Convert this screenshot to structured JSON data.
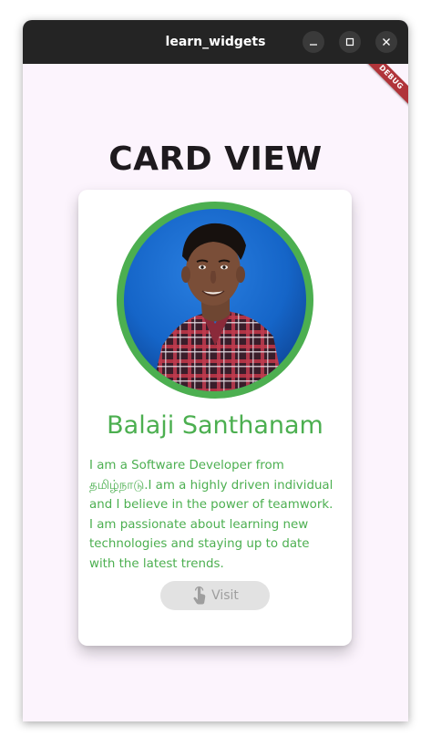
{
  "window": {
    "title": "learn_widgets"
  },
  "debug_banner": "DEBUG",
  "page": {
    "heading": "CARD VIEW"
  },
  "card": {
    "name": "Balaji Santhanam",
    "bio_lines": [
      "I am a Software Developer from",
      "தமிழ்நாடு.I am a highly driven individual",
      "and I believe in the power of teamwork.",
      "I am passionate about learning new",
      "technologies and staying up to date",
      "with the latest trends."
    ],
    "visit_label": "Visit",
    "visit_icon": "touch-app-icon"
  },
  "colors": {
    "accent": "#4caf50",
    "background": "#fcf4fd",
    "titlebar": "#242424",
    "button_disabled": "#e2e2e2"
  }
}
